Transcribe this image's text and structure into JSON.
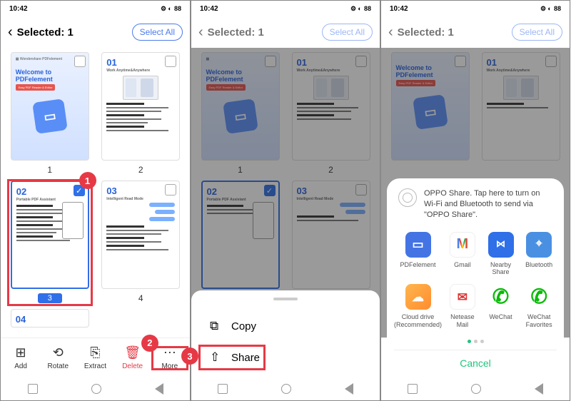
{
  "status": {
    "time": "10:42",
    "battery": "88"
  },
  "header": {
    "title": "Selected: 1",
    "select_all": "Select All"
  },
  "pages": {
    "p1": {
      "num": "1",
      "welcome_to": "Welcome to",
      "app": "PDFelement",
      "band": "Easy PDF Reader & Editor"
    },
    "p2": {
      "num": "2",
      "big": "01",
      "sub": "Work Anytime&Anywhere"
    },
    "p3": {
      "num": "3",
      "big": "02",
      "sub": "Portable PDF Assistant"
    },
    "p4": {
      "num": "4",
      "big": "03",
      "sub": "Intelligent Read Mode"
    },
    "p5": {
      "big": "04"
    }
  },
  "toolbar": {
    "add": "Add",
    "rotate": "Rotate",
    "extract": "Extract",
    "delete": "Delete",
    "more": "More"
  },
  "sheet": {
    "copy": "Copy",
    "share": "Share"
  },
  "share": {
    "oppo_text": "OPPO Share. Tap here to turn on Wi-Fi and Bluetooth to send via \"OPPO Share\".",
    "apps": {
      "pdfelement": "PDFelement",
      "gmail": "Gmail",
      "nearby": "Nearby Share",
      "bluetooth": "Bluetooth",
      "cloud": "Cloud drive (Recommended)",
      "netease": "Netease Mail",
      "wechat": "WeChat",
      "wechat_fav": "WeChat Favorites"
    },
    "cancel": "Cancel"
  },
  "badges": {
    "b1": "1",
    "b2": "2",
    "b3": "3"
  }
}
